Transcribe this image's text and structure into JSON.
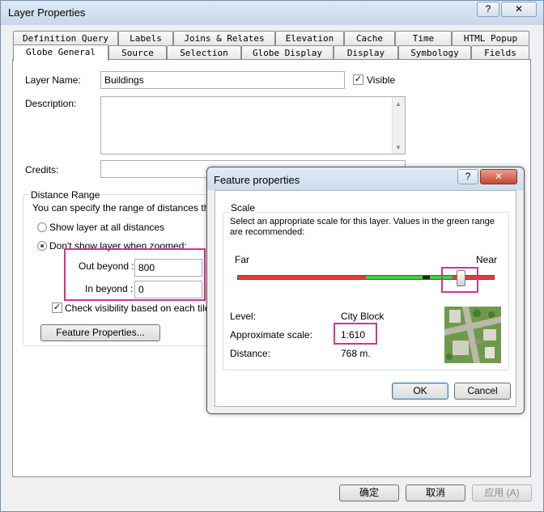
{
  "window": {
    "title": "Layer Properties",
    "help_label": "?",
    "close_label": "✕"
  },
  "tabs_row1": [
    "Definition Query",
    "Labels",
    "Joins & Relates",
    "Elevation",
    "Cache",
    "Time",
    "HTML Popup"
  ],
  "tabs_row2": [
    "Globe General",
    "Source",
    "Selection",
    "Globe Display",
    "Display",
    "Symbology",
    "Fields"
  ],
  "general": {
    "layer_name_label": "Layer Name:",
    "layer_name_value": "Buildings",
    "visible_label": "Visible",
    "visible_checked": "✓",
    "description_label": "Description:",
    "credits_label": "Credits:",
    "distance_group_label": "Distance Range",
    "distance_hint": "You can specify the range of distances this la",
    "radio_all": "Show layer at all distances",
    "radio_zoomed": "Don't show layer when zoomed:",
    "out_beyond_label": "Out beyond :",
    "out_beyond_value": "800",
    "in_beyond_label": "In beyond :",
    "in_beyond_value": "0",
    "check_tile_label": "Check visibility based on each tile dis",
    "check_tile_checked": "✓",
    "feature_props_button": "Feature Properties..."
  },
  "footer": {
    "ok": "确定",
    "cancel": "取消",
    "apply": "应用 (A)"
  },
  "popup": {
    "title": "Feature properties",
    "help_label": "?",
    "close_label": "✕",
    "scale_group_label": "Scale",
    "instruction": "Select an appropriate scale for this layer. Values in the green range are recommended:",
    "far_label": "Far",
    "near_label": "Near",
    "slider_position": 0.87,
    "green_range": [
      0.5,
      0.84
    ],
    "level_label": "Level:",
    "level_value": "City Block",
    "approx_scale_label": "Approximate scale:",
    "approx_scale_value": "1:610",
    "distance_label": "Distance:",
    "distance_value": "768 m.",
    "ok": "OK",
    "cancel": "Cancel",
    "colors": {
      "red": "#e23b3b",
      "green": "#3fcf3f",
      "dark": "#222222"
    }
  }
}
